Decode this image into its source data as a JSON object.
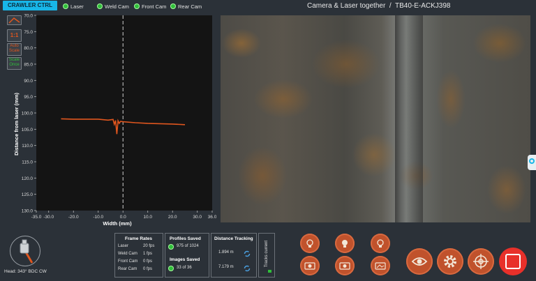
{
  "header": {
    "mode_button": "CRAWLER CTRL",
    "toggles": [
      {
        "label": "Laser"
      },
      {
        "label": "Weld Cam"
      },
      {
        "label": "Front Cam"
      },
      {
        "label": "Rear Cam"
      }
    ],
    "view_title": "Camera & Laser together",
    "separator": "/",
    "device_id": "TB40-E-ACKJ398"
  },
  "tools": {
    "ratio": "1:1",
    "auto_scale": [
      "Auto",
      "Scale"
    ],
    "scale_once": [
      "Scale",
      "Once"
    ]
  },
  "chart_data": {
    "type": "line",
    "xlabel": "Width (mm)",
    "ylabel": "Distance from laser (mm)",
    "xlim": [
      -35.0,
      36.0
    ],
    "ylim": [
      130.0,
      70.0
    ],
    "y_inverted": true,
    "x_ticks": [
      "-35.0",
      "-30.0",
      "-20.0",
      "-10.0",
      "0.0",
      "10.0",
      "20.0",
      "30.0",
      "36.0"
    ],
    "x_tick_values": [
      -35,
      -30,
      -20,
      -10,
      0,
      10,
      20,
      30,
      36
    ],
    "y_ticks": [
      "70.0",
      "75.0",
      "80.0",
      "85.0",
      "90.0",
      "95.0",
      "100.0",
      "105.0",
      "110.0",
      "115.0",
      "120.0",
      "125.0",
      "130.0"
    ],
    "y_tick_values": [
      70,
      75,
      80,
      85,
      90,
      95,
      100,
      105,
      110,
      115,
      120,
      125,
      130
    ],
    "center_line_x": 0,
    "series": [
      {
        "color": "#e0561e",
        "x": [
          -25,
          -20,
          -15,
          -10,
          -6,
          -4,
          -3.5,
          -3,
          -2.5,
          -2,
          -1.5,
          -1,
          0,
          5,
          10,
          15,
          20,
          25
        ],
        "y": [
          101.8,
          101.9,
          101.9,
          101.9,
          102.2,
          102.0,
          103.5,
          102.3,
          106.5,
          102.4,
          103.2,
          102.6,
          102.7,
          103.0,
          103.2,
          103.3,
          103.4,
          103.6
        ]
      }
    ]
  },
  "frame_rates": {
    "title": "Frame Rates",
    "rows": [
      {
        "name": "Laser",
        "value": "20 fps"
      },
      {
        "name": "Weld Cam",
        "value": "1 fps"
      },
      {
        "name": "Front Cam",
        "value": "0 fps"
      },
      {
        "name": "Rear Cam",
        "value": "0 fps"
      }
    ]
  },
  "profiles_saved": {
    "title": "Profiles Saved",
    "value": "975 of 1024"
  },
  "images_saved": {
    "title": "Images Saved",
    "value": "33 of 36"
  },
  "distance_tracking": {
    "title": "Distance Tracking",
    "rows": [
      "1.894 m",
      "7.179 m"
    ]
  },
  "tracks_current": "Tracks current",
  "head": {
    "label": "Head:",
    "value": "343° BDC CW"
  },
  "colors": {
    "accent": "#18b6e8",
    "orange": "#c0522c",
    "status_green": "#2fbf3a",
    "stop_red": "#e8302a"
  },
  "icons": [
    "crawler-head-icon",
    "sync-icon",
    "light-icon",
    "camera-icon",
    "eye-icon",
    "gear-icon",
    "crosshair-icon",
    "stop-icon"
  ]
}
